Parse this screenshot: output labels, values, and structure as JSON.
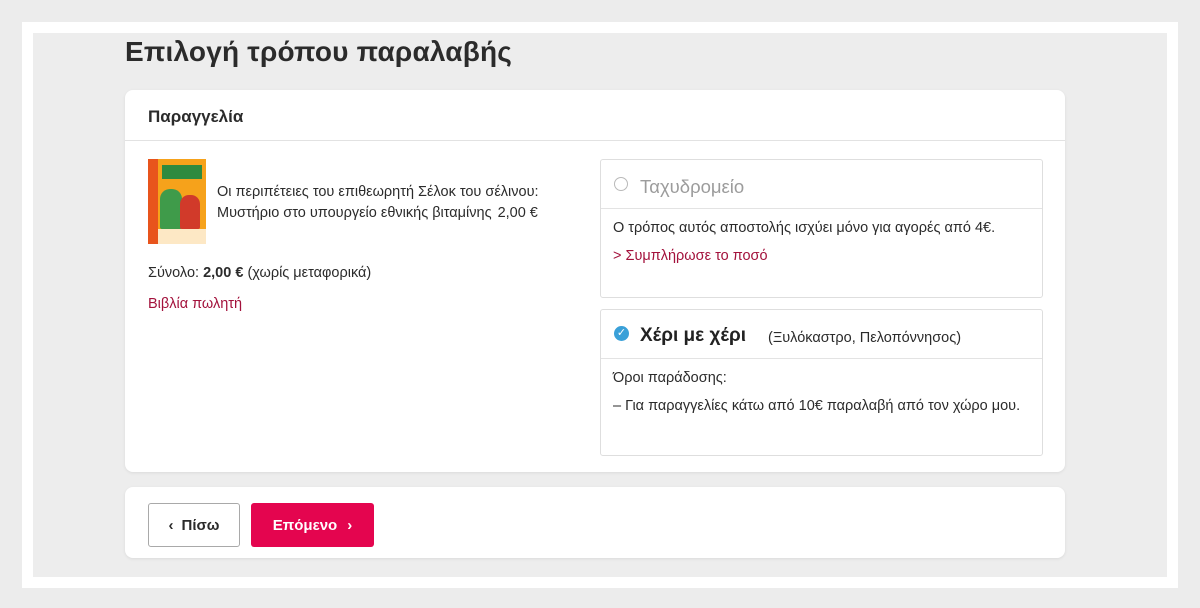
{
  "page": {
    "title": "Επιλογή τρόπου παραλαβής"
  },
  "order": {
    "header": "Παραγγελία",
    "book": {
      "cover_icon": "book-cover-image",
      "title_line1": "Οι περιπέτειες του επιθεωρητή Σέλοκ του σέλινου:",
      "title_line2": "Μυστήριο στο υπουργείο εθνικής βιταμίνης",
      "price": "2,00 €"
    },
    "total_label": "Σύνολο:",
    "total_value": "2,00 €",
    "total_note": "(χωρίς μεταφορικά)",
    "seller_link": "Βιβλία πωλητή"
  },
  "shipping": {
    "post": {
      "name": "Ταχυδρομείο",
      "selected": false,
      "enabled": false,
      "message": "Ο τρόπος αυτός αποστολής ισχύει μόνο για αγορές από 4€.",
      "link": "> Συμπλήρωσε το ποσό"
    },
    "hand": {
      "name": "Χέρι με χέρι",
      "selected": true,
      "location": "(Ξυλόκαστρο, Πελοπόννησος)",
      "terms_label": "Όροι παράδοσης:",
      "terms_text": "– Για παραγγελίες κάτω από 10€ παραλαβή από τον χώρο μου."
    }
  },
  "nav": {
    "back_label": "Πίσω",
    "back_icon": "chevron-left-icon",
    "next_label": "Επόμενο",
    "next_icon": "chevron-right-icon"
  },
  "colors": {
    "accent": "#e4054f",
    "link": "#a3123c",
    "radio_checked": "#3aa0d8",
    "background": "#ededed"
  }
}
